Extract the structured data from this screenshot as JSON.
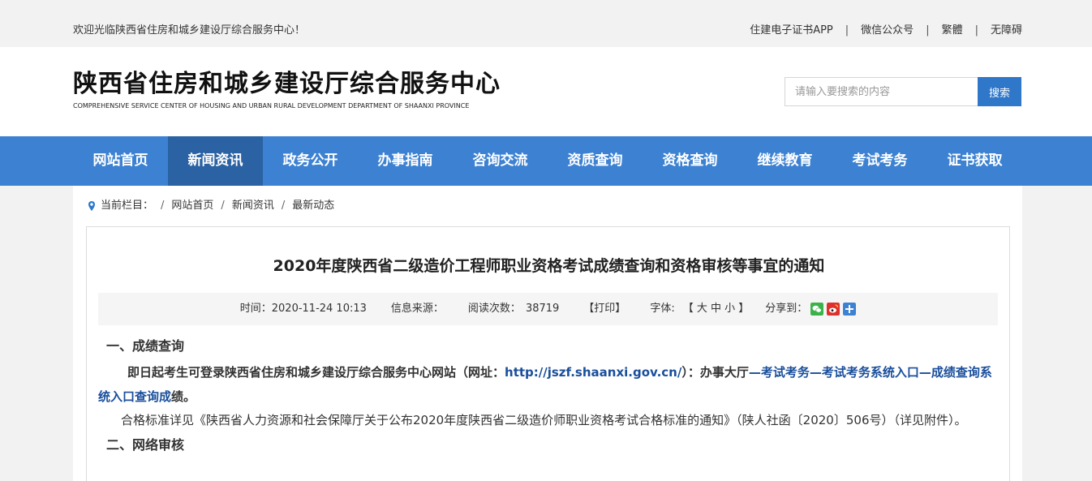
{
  "topbar": {
    "welcome": "欢迎光临陕西省住房和城乡建设厅综合服务中心！",
    "links": [
      "住建电子证书APP",
      "微信公众号",
      "繁體",
      "无障碍"
    ],
    "separator": "|"
  },
  "header": {
    "logo_cn": "陕西省住房和城乡建设厅综合服务中心",
    "logo_en": "COMPREHENSIVE SERVICE CENTER OF HOUSING AND URBAN RURAL DEVELOPMENT DEPARTMENT OF SHAANXI PROVINCE",
    "search_placeholder": "请输入要搜索的内容",
    "search_button": "搜索"
  },
  "nav": {
    "items": [
      "网站首页",
      "新闻资讯",
      "政务公开",
      "办事指南",
      "咨询交流",
      "资质查询",
      "资格查询",
      "继续教育",
      "考试考务",
      "证书获取"
    ],
    "active_index": 1
  },
  "breadcrumb": {
    "label": "当前栏目：",
    "items": [
      "网站首页",
      "新闻资讯",
      "最新动态"
    ],
    "separator": "/"
  },
  "article": {
    "title": "2020年度陕西省二级造价工程师职业资格考试成绩查询和资格审核等事宜的通知",
    "meta": {
      "time": "时间：2020-11-24 10:13",
      "source": "信息来源：",
      "views_label": "阅读次数：",
      "views": "38719",
      "print": "【打印】",
      "font_label": "字体:",
      "font_sizes": "【 大 中 小 】",
      "share": "分享到："
    },
    "sections": {
      "s1_heading": "一、成绩查询",
      "s1_p1_a": "即日起考生可登录陕西省住房和城乡建设厅综合服务中心网站（网址：",
      "s1_p1_url": "http://jszf.shaanxi.gov.cn/",
      "s1_p1_b": "）：办事大厅",
      "s1_p1_path": "—考试考务—考试考务系统入口—成绩查询系统入口查询成",
      "s1_p1_c": "绩。",
      "s1_p2": "合格标准详见《陕西省人力资源和社会保障厅关于公布2020年度陕西省二级造价师职业资格考试合格标准的通知》（陕人社函〔2020〕506号）（详见附件）。",
      "s2_heading": "二、网络审核"
    }
  },
  "colors": {
    "nav_bg": "#3d82d2",
    "nav_active": "#2a62a3",
    "search_btn": "#2e77c9",
    "link": "#1a4f9c"
  },
  "icons": {
    "breadcrumb": "location-pin-icon",
    "share": [
      "wechat-icon",
      "weibo-icon",
      "more-share-icon"
    ]
  }
}
